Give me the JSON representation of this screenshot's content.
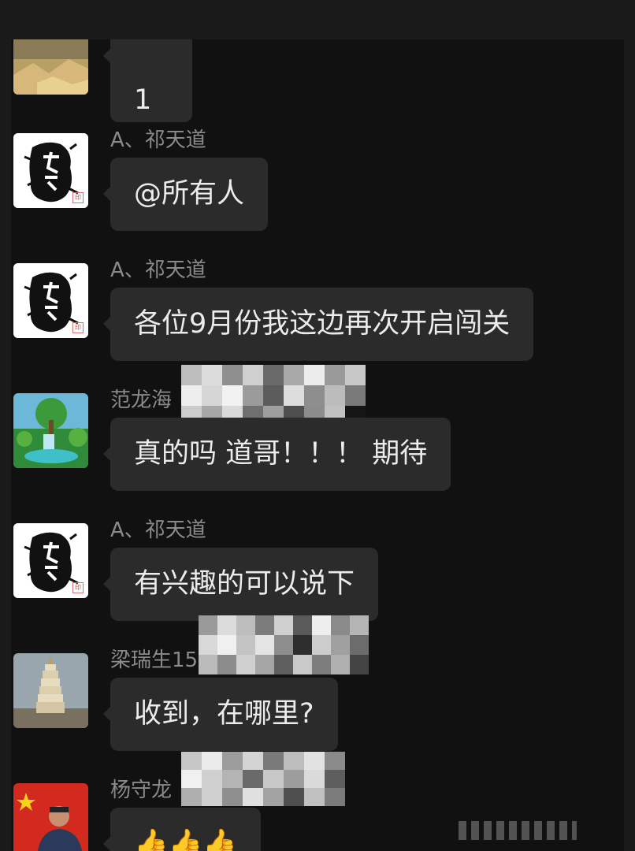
{
  "messages": [
    {
      "sender": "",
      "avatar": "landscape-avatar",
      "text": "1"
    },
    {
      "sender": "A、祁天道",
      "avatar": "tiandao-logo-avatar",
      "text": "@所有人"
    },
    {
      "sender": "A、祁天道",
      "avatar": "tiandao-logo-avatar",
      "text": "各位9月份我这边再次开启闯关"
    },
    {
      "sender": "范龙海",
      "avatar": "waterfall-avatar",
      "text": "真的吗  道哥！！！ 期待"
    },
    {
      "sender": "A、祁天道",
      "avatar": "tiandao-logo-avatar",
      "text": "有兴趣的可以说下"
    },
    {
      "sender": "梁瑞生15",
      "avatar": "pagoda-avatar",
      "text": "收到，在哪里?"
    },
    {
      "sender": "杨守龙",
      "avatar": "flag-portrait-avatar",
      "text": "👍👍👍"
    }
  ],
  "colors": {
    "background": "#111111",
    "bubble": "#2b2b2b",
    "bubble_text": "#ececec",
    "sender_name": "#8a8a8a"
  }
}
